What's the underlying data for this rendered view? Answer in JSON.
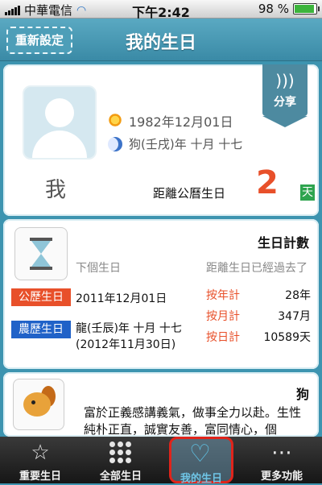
{
  "statusbar": {
    "carrier": "中華電信",
    "time": "下午2:42",
    "battery": "98 %",
    "battery_level": 0.98
  },
  "navbar": {
    "title": "我的生日",
    "reset_label": "重新設定"
  },
  "profile": {
    "solar_date": "1982年12月01日",
    "lunar_date": "狗(壬戌)年 十月 十七",
    "name": "我",
    "distance_label": "距離公曆生日",
    "days_remaining": "2",
    "day_unit": "天",
    "share_label": "分享"
  },
  "counter": {
    "title": "生日計數",
    "next_label": "下個生日",
    "passed_label": "距離生日已經過去了",
    "solar_tag": "公歷生日",
    "lunar_tag": "農歷生日",
    "next_solar": "2011年12月01日",
    "next_lunar_line1": "龍(壬辰)年 十月 十七",
    "next_lunar_line2": "(2012年11月30日)",
    "stats": [
      {
        "label": "按年計",
        "value": "28年"
      },
      {
        "label": "按月計",
        "value": "347月"
      },
      {
        "label": "按日計",
        "value": "10589天"
      }
    ]
  },
  "zodiac": {
    "name": "狗",
    "description": "富於正義感講義氣，做事全力以赴。生性純朴正直，誠實友善，富同情心，個"
  },
  "tabbar": {
    "tabs": [
      {
        "label": "重要生日"
      },
      {
        "label": "全部生日"
      },
      {
        "label": "我的生日"
      },
      {
        "label": "更多功能"
      }
    ]
  }
}
